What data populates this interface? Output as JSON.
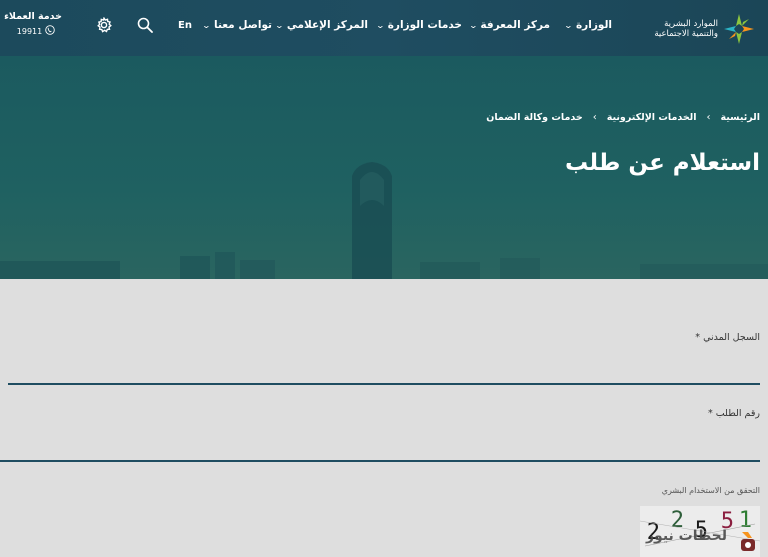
{
  "header": {
    "logo_text_line1": "الموارد البشرية",
    "logo_text_line2": "والتنمية الاجتماعية",
    "nav": [
      {
        "label": "الوزارة"
      },
      {
        "label": "مركز المعرفة"
      },
      {
        "label": "خدمات الوزارة"
      },
      {
        "label": "المركز الإعلامي"
      },
      {
        "label": "تواصل معنا"
      }
    ],
    "lang_label": "En",
    "customer_service": {
      "title": "خدمة العملاء",
      "number": "19911"
    },
    "icons": [
      "search-icon",
      "settings-gear-icon",
      "phone-icon",
      "chevron-down-icon"
    ]
  },
  "hero": {
    "breadcrumb": [
      "الرئيسية",
      "الخدمات الإلكترونية",
      "خدمات وكالة الضمان"
    ],
    "title": "استعلام عن طلب"
  },
  "form": {
    "civil_id_label": "السجل المدني *",
    "civil_id_value": "",
    "request_number_label": "رقم الطلب *",
    "request_number_value": "",
    "captcha_label": "التحقق من الاستخدام البشري",
    "captcha_digits": [
      "1",
      "5",
      "5",
      "2",
      "2"
    ]
  },
  "watermark": {
    "text": "لحظات نيوز"
  },
  "colors": {
    "header_bg": "#1f4d61",
    "hero_bg": "#1d5c60",
    "form_bg": "#dedede",
    "input_underline": "#1f4d61",
    "logo_green": "#8cc63f",
    "logo_orange": "#f7941d"
  }
}
